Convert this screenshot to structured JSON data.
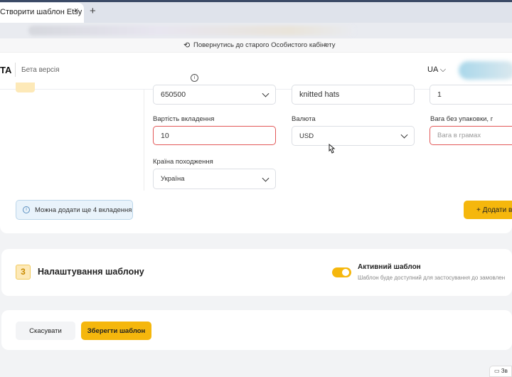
{
  "browser": {
    "tab_title": "Створити шаблон Etsy",
    "tab_close": "×",
    "new_tab": "+"
  },
  "banner": {
    "icon": "refresh-icon",
    "text": "Повернутись до старого Особистого кабінету",
    "chevron": "›"
  },
  "header": {
    "logo": "TA",
    "beta_label": "Бета версія",
    "info_glyph": "i",
    "language": "UA ⌵"
  },
  "form": {
    "row1": {
      "field_a_value": "650500",
      "field_b_value": "knitted hats",
      "field_c_value": "1"
    },
    "attachment_value": {
      "label": "Вартість вкладення",
      "value": "10"
    },
    "currency": {
      "label": "Валюта",
      "value": "USD"
    },
    "weight": {
      "label": "Вага без упаковки, г",
      "placeholder": "Вага в грамах"
    },
    "country": {
      "label": "Країна походження",
      "value": "Україна"
    },
    "note": {
      "icon": "info-icon",
      "glyph": "i",
      "text": "Можна додати ще 4 вкладення"
    },
    "add_button": "+  Додати в"
  },
  "settings": {
    "step_number": "3",
    "title": "Налаштування шаблону",
    "toggle_on": true,
    "active_title": "Активний шаблон",
    "active_desc": "Шаблон буде доступний для застосування до замовлен"
  },
  "actions": {
    "cancel": "Скасувати",
    "save": "Зберегти шаблон"
  },
  "chat_label": "Зв",
  "colors": {
    "accent": "#f5b70d",
    "error": "#e25858",
    "info_bg": "#e9f3fb"
  }
}
